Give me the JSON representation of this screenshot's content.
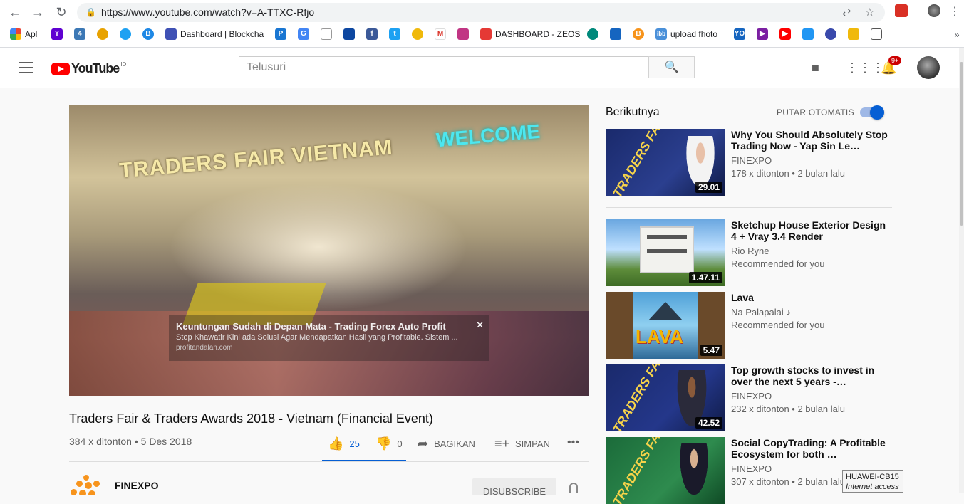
{
  "browser": {
    "url": "https://www.youtube.com/watch?v=A-TTXC-Rfjo",
    "bookmarks": [
      "Apl",
      "Dashboard | Blockcha",
      "DASHBOARD - ZEOS",
      "upload fhoto"
    ]
  },
  "header": {
    "logo_text": "YouTube",
    "country": "ID",
    "search_placeholder": "Telusuri",
    "notifications": "9+"
  },
  "video": {
    "title": "Traders Fair & Traders Awards 2018 - Vietnam (Financial Event)",
    "meta": "384 x ditonton • 5 Des 2018",
    "likes": "25",
    "dislikes": "0",
    "share_label": "BAGIKAN",
    "save_label": "SIMPAN",
    "scene_banner": "TRADERS FAIR VIETNAM",
    "scene_welcome": "WELCOME",
    "ad": {
      "title": "Keuntungan Sudah di Depan Mata - Trading Forex Auto Profit",
      "desc": "Stop Khawatir Kini ada Solusi Agar Mendapatkan Hasil yang Profitable. Sistem ...",
      "url": "profitandalan.com"
    }
  },
  "channel": {
    "name": "FINEXPO",
    "subscribe_label": "DISUBSCRIBE"
  },
  "sidebar": {
    "next_label": "Berikutnya",
    "autoplay_label": "PUTAR OTOMATIS",
    "items": [
      {
        "title": "Why You Should Absolutely Stop Trading Now - Yap Sin Le…",
        "channel": "FINEXPO",
        "meta": "178 x ditonton • 2 bulan lalu",
        "duration": "29.01"
      },
      {
        "title": "Sketchup House Exterior Design 4 + Vray 3.4 Render",
        "channel": "Rio Ryne",
        "meta": "Recommended for you",
        "duration": "1.47.11"
      },
      {
        "title": "Lava",
        "channel": "Na Palapalai",
        "meta": "Recommended for you",
        "duration": "5.47"
      },
      {
        "title": "Top growth stocks to invest in over the next 5 years -…",
        "channel": "FINEXPO",
        "meta": "232 x ditonton • 2 bulan lalu",
        "duration": "42.52"
      },
      {
        "title": "Social CopyTrading: A Profitable Ecosystem for both …",
        "channel": "FINEXPO",
        "meta": "307 x ditonton • 2 bulan lalu",
        "duration": ""
      }
    ]
  },
  "tooltip": {
    "line1": "HUAWEI-CB15",
    "line2": "Internet access"
  }
}
